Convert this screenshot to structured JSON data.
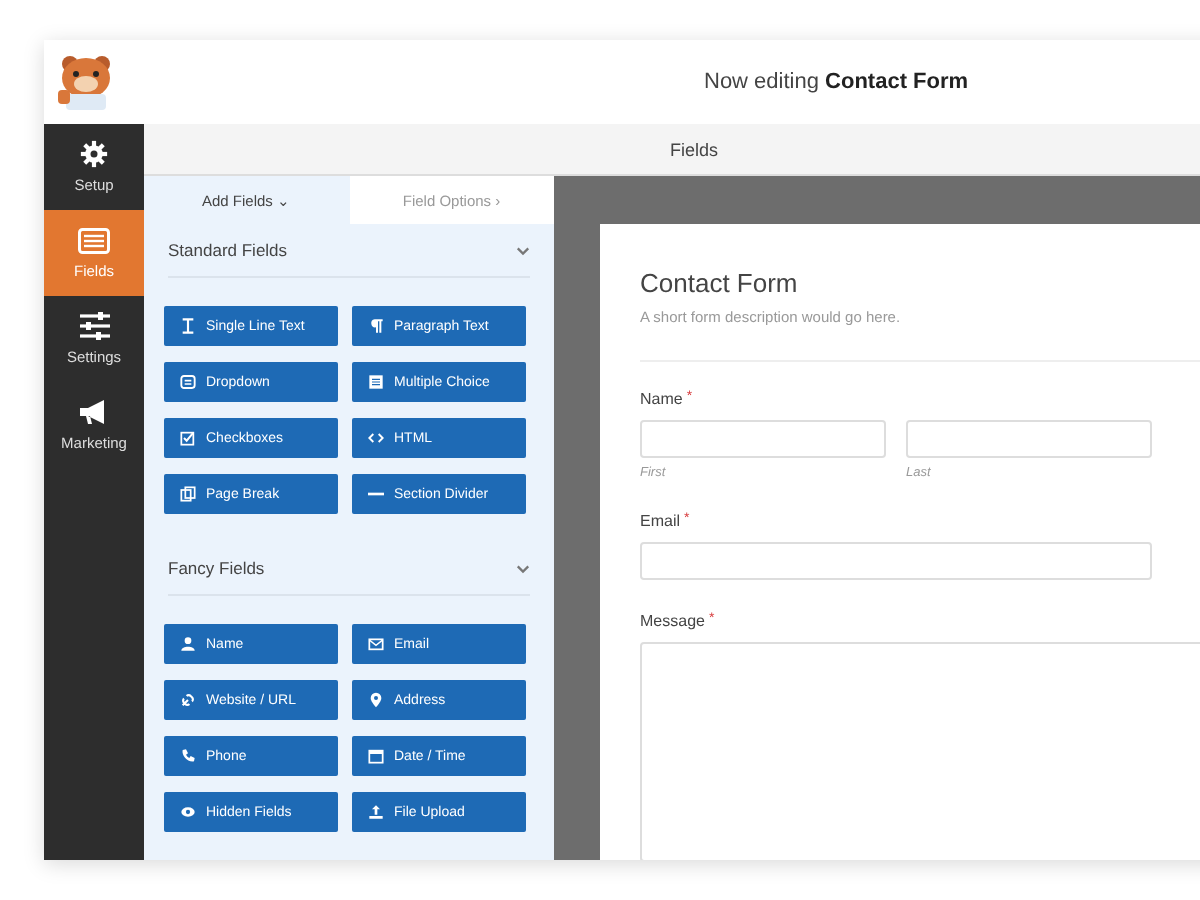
{
  "header": {
    "prefix": "Now editing",
    "form_name": "Contact Form"
  },
  "sidebar": {
    "items": [
      {
        "label": "Setup",
        "selected": false
      },
      {
        "label": "Fields",
        "selected": true
      },
      {
        "label": "Settings",
        "selected": false
      },
      {
        "label": "Marketing",
        "selected": false
      }
    ]
  },
  "top_bar": {
    "title": "Fields"
  },
  "panel_tabs": [
    {
      "label": "Add Fields",
      "caret": "⌄",
      "selected": true
    },
    {
      "label": "Field Options",
      "caret": "›",
      "selected": false
    }
  ],
  "sections": [
    {
      "title": "Standard Fields",
      "expanded": true,
      "buttons": [
        "Single Line Text",
        "Paragraph Text",
        "Dropdown",
        "Multiple Choice",
        "Checkboxes",
        "HTML",
        "Page Break",
        "Section Divider"
      ]
    },
    {
      "title": "Fancy Fields",
      "expanded": true,
      "buttons": [
        "Name",
        "Email",
        "Website / URL",
        "Address",
        "Phone",
        "Date / Time",
        "Hidden Fields",
        "File Upload"
      ]
    }
  ],
  "form": {
    "title": "Contact Form",
    "description": "A short form description would go here.",
    "fields": [
      {
        "kind": "name",
        "label": "Name",
        "required_mark": "*",
        "sublabels": [
          "First",
          "Last"
        ]
      },
      {
        "kind": "text",
        "label": "Email",
        "required_mark": "*"
      },
      {
        "kind": "textarea",
        "label": "Message",
        "required_mark": "*"
      }
    ]
  }
}
